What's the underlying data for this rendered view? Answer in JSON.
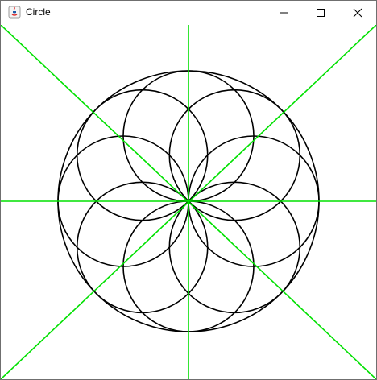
{
  "window": {
    "title": "Circle",
    "app_icon": "java-icon",
    "controls": [
      "minimize-icon",
      "maximize-icon",
      "close-icon"
    ]
  },
  "drawing": {
    "axis_color": "#00e000",
    "circle_color": "#000000",
    "outer_circle_count": 1,
    "inner_circle_count": 8,
    "axis_line_count": 4
  }
}
